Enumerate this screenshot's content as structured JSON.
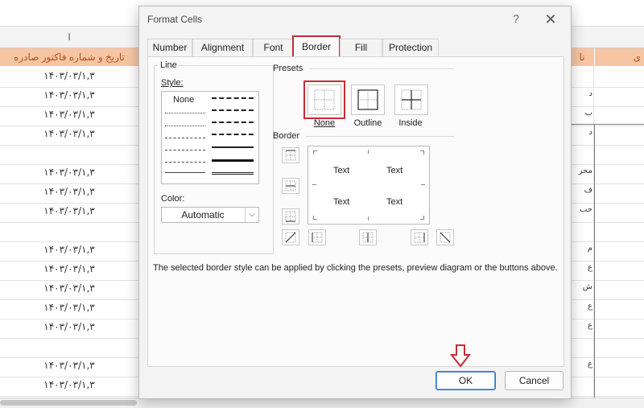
{
  "spreadsheet": {
    "column_letter": "I",
    "header_left": "تاریخ و شماره فاکتور صادره",
    "header_right_partial": "نا",
    "header_far_right": "ی",
    "date_value": "۱۴۰۳/۰۳/۱,۳",
    "rows": [
      {
        "date": "۱۴۰۳/۰۳/۱,۳",
        "right": ""
      },
      {
        "date": "۱۴۰۳/۰۳/۱,۳",
        "right": "د"
      },
      {
        "date": "۱۴۰۳/۰۳/۱,۳",
        "right": "ب"
      },
      {
        "date": "۱۴۰۳/۰۳/۱,۳",
        "right": "د"
      },
      {
        "date": "",
        "right": ""
      },
      {
        "date": "۱۴۰۳/۰۳/۱,۳",
        "right": "محر"
      },
      {
        "date": "۱۴۰۳/۰۳/۱,۳",
        "right": "ف"
      },
      {
        "date": "۱۴۰۳/۰۳/۱,۳",
        "right": "حب"
      },
      {
        "date": "",
        "right": ""
      },
      {
        "date": "۱۴۰۳/۰۳/۱,۳",
        "right": "م"
      },
      {
        "date": "۱۴۰۳/۰۳/۱,۳",
        "right": "ع"
      },
      {
        "date": "۱۴۰۳/۰۳/۱,۳",
        "right": "ش"
      },
      {
        "date": "۱۴۰۳/۰۳/۱,۳",
        "right": "ع"
      },
      {
        "date": "۱۴۰۳/۰۳/۱,۳",
        "right": "ع"
      },
      {
        "date": "",
        "right": ""
      },
      {
        "date": "۱۴۰۳/۰۳/۱,۳",
        "right": "ع"
      },
      {
        "date": "۱۴۰۳/۰۳/۱,۳",
        "right": ""
      }
    ]
  },
  "dialog": {
    "title": "Format Cells",
    "help": "?",
    "close": "✕",
    "tabs": [
      "Number",
      "Alignment",
      "Font",
      "Border",
      "Fill",
      "Protection"
    ],
    "active_tab": "Border",
    "line_group": {
      "label": "Line",
      "style_label": "Style:",
      "none_label": "None",
      "color_label": "Color:",
      "color_value": "Automatic"
    },
    "presets": {
      "label": "Presets",
      "items": [
        "None",
        "Outline",
        "Inside"
      ],
      "selected": "None"
    },
    "border": {
      "label": "Border",
      "preview_text": [
        "Text",
        "Text",
        "Text",
        "Text"
      ]
    },
    "info_text": "The selected border style can be applied by clicking the presets, preview diagram or the buttons above.",
    "ok_label": "OK",
    "cancel_label": "Cancel"
  },
  "colors": {
    "highlight": "#c62c34",
    "header_fill": "#f6c5a4",
    "header_text": "#b0511c",
    "ok_border": "#2e6fd1"
  }
}
